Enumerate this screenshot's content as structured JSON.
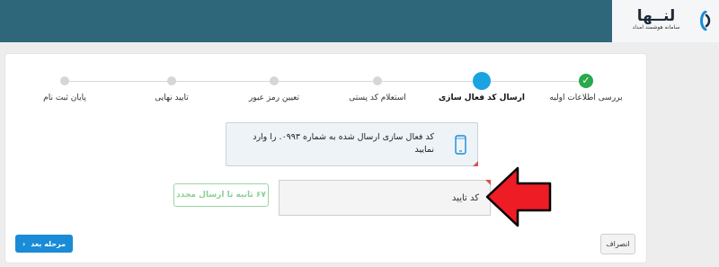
{
  "header": {
    "brand_name": "لنــها",
    "brand_tagline": "سامانه هوشمند امداد"
  },
  "stepper": {
    "steps": [
      {
        "label": "بررسی اطلاعات اولیه",
        "state": "done"
      },
      {
        "label": "ارسال کد فعال سازی",
        "state": "active"
      },
      {
        "label": "استعلام کد پستی",
        "state": "pending"
      },
      {
        "label": "تعیین رمز عبور",
        "state": "pending"
      },
      {
        "label": "تایید نهایی",
        "state": "pending"
      },
      {
        "label": "پایان ثبت نام",
        "state": "pending"
      }
    ]
  },
  "info": {
    "message_line1": "کد فعال سازی ارسال شده به شماره           ۰۹۹۳. را وارد",
    "message_line2": "نمایید",
    "icon": "phone-icon"
  },
  "form": {
    "code_placeholder": "کد تایید",
    "resend_label": "۶۷ ثانیه تا ارسال مجدد"
  },
  "actions": {
    "next_label": "مرحله بعد",
    "cancel_label": "انصراف"
  },
  "colors": {
    "header_bg": "#2e6779",
    "done": "#2aa94a",
    "active": "#1aa3e0",
    "primary": "#1a8bd6",
    "annotation_arrow": "#ee1c24"
  }
}
